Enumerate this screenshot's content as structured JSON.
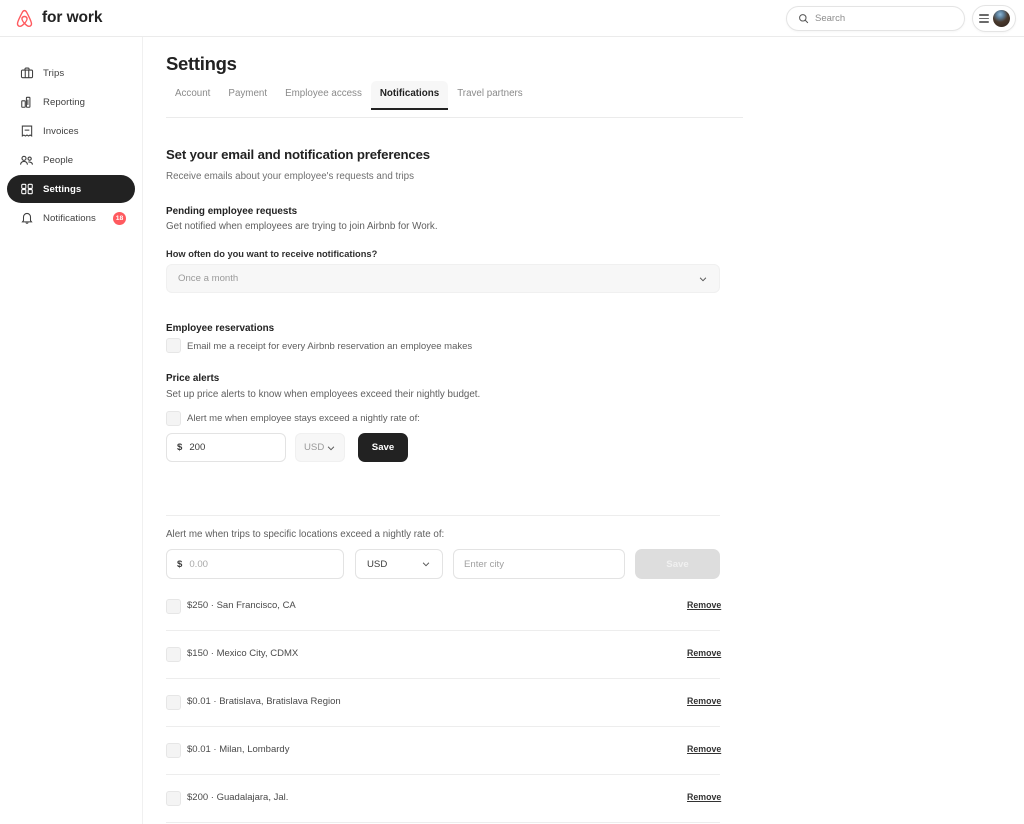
{
  "brand": {
    "name": "for work",
    "logo": "airbnb-belo-icon",
    "logo_color": "#FF5A5F"
  },
  "topbar": {
    "search": {
      "placeholder": "Search",
      "icon": "search-icon"
    },
    "account": {
      "menu_icon": "hamburger-icon",
      "avatar": "user-avatar"
    }
  },
  "sidebar": {
    "items": [
      {
        "label": "Trips",
        "icon": "briefcase-icon",
        "active": false
      },
      {
        "label": "Reporting",
        "icon": "bar-chart-icon",
        "active": false
      },
      {
        "label": "Invoices",
        "icon": "receipt-icon",
        "active": false
      },
      {
        "label": "People",
        "icon": "people-icon",
        "active": false
      },
      {
        "label": "Settings",
        "icon": "dashboard-grid-icon",
        "active": true
      },
      {
        "label": "Notifications",
        "icon": "bell-icon",
        "active": false,
        "badge": "18"
      }
    ],
    "badge_color": "#FF5A5F"
  },
  "page": {
    "title": "Settings",
    "tabs": [
      {
        "label": "Account",
        "active": false
      },
      {
        "label": "Payment",
        "active": false
      },
      {
        "label": "Employee access",
        "active": false
      },
      {
        "label": "Notifications",
        "active": true
      },
      {
        "label": "Travel partners",
        "active": false
      }
    ]
  },
  "notifications": {
    "heading": "Set your email and notification preferences",
    "subheading": "Receive emails about your employee's requests and trips",
    "pending": {
      "title": "Pending employee requests",
      "description": "Get notified when employees are trying to join Airbnb for Work.",
      "frequency_label": "How often do you want to receive notifications?",
      "frequency_value": "Once a month",
      "frequency_options": [
        "Once a month"
      ]
    },
    "reservations": {
      "title": "Employee reservations",
      "checkbox_label": "Email me a receipt for every Airbnb reservation an employee makes",
      "checked": false
    },
    "price_alerts": {
      "title": "Price alerts",
      "description": "Set up price alerts to know when employees exceed their nightly budget.",
      "global": {
        "checkbox_label": "Alert me when employee stays exceed a nightly rate of:",
        "checked": false,
        "currency_symbol": "$",
        "amount": "200",
        "currency": "USD",
        "save_label": "Save",
        "save_enabled": true
      },
      "location": {
        "label": "Alert me when trips to specific locations exceed a nightly rate of:",
        "currency_symbol": "$",
        "amount_placeholder": "0.00",
        "currency": "USD",
        "city_placeholder": "Enter city",
        "save_label": "Save",
        "save_enabled": false
      },
      "saved_alerts": [
        {
          "text": "$250 · San Francisco, CA",
          "remove_label": "Remove",
          "checked": false
        },
        {
          "text": "$150 · Mexico City, CDMX",
          "remove_label": "Remove",
          "checked": false
        },
        {
          "text": "$0.01 · Bratislava, Bratislava Region",
          "remove_label": "Remove",
          "checked": false
        },
        {
          "text": "$0.01 · Milan, Lombardy",
          "remove_label": "Remove",
          "checked": false
        },
        {
          "text": "$200 · Guadalajara, Jal.",
          "remove_label": "Remove",
          "checked": false
        }
      ]
    }
  }
}
